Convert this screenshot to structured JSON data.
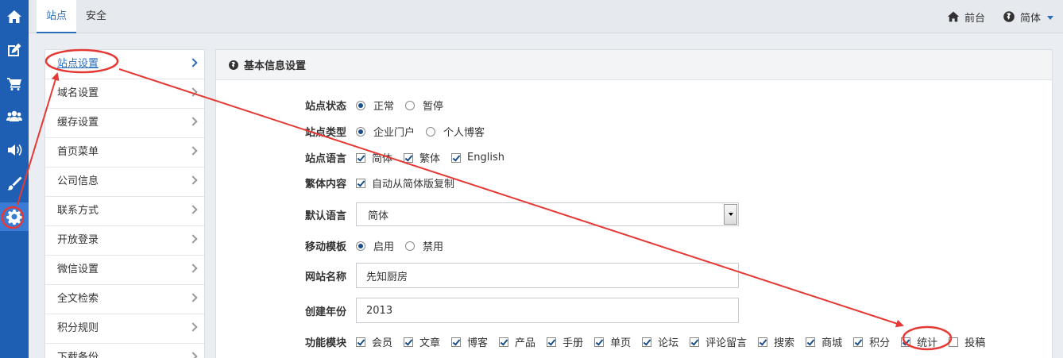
{
  "rail": {
    "items": [
      {
        "icon": "home-icon"
      },
      {
        "icon": "edit-icon"
      },
      {
        "icon": "cart-icon"
      },
      {
        "icon": "users-icon"
      },
      {
        "icon": "speaker-icon"
      },
      {
        "icon": "brush-icon"
      },
      {
        "icon": "gear-icon"
      }
    ]
  },
  "topbar": {
    "tabs": [
      {
        "label": "站点"
      },
      {
        "label": "安全"
      }
    ],
    "frontend_label": "前台",
    "language_label": "简体"
  },
  "submenu": {
    "items": [
      {
        "label": "站点设置"
      },
      {
        "label": "域名设置"
      },
      {
        "label": "缓存设置"
      },
      {
        "label": "首页菜单"
      },
      {
        "label": "公司信息"
      },
      {
        "label": "联系方式"
      },
      {
        "label": "开放登录"
      },
      {
        "label": "微信设置"
      },
      {
        "label": "全文检索"
      },
      {
        "label": "积分规则"
      },
      {
        "label": "下载备份"
      }
    ]
  },
  "panel": {
    "title": "基本信息设置",
    "site_status": {
      "label": "站点状态",
      "options": [
        "正常",
        "暂停"
      ],
      "selected": "正常"
    },
    "site_type": {
      "label": "站点类型",
      "options": [
        "企业门户",
        "个人博客"
      ],
      "selected": "企业门户"
    },
    "site_language": {
      "label": "站点语言",
      "options": [
        "简体",
        "繁体",
        "English"
      ]
    },
    "traditional_content": {
      "label": "繁体内容",
      "option": "自动从简体版复制"
    },
    "default_language": {
      "label": "默认语言",
      "value": "简体"
    },
    "mobile_template": {
      "label": "移动模板",
      "options": [
        "启用",
        "禁用"
      ],
      "selected": "启用"
    },
    "site_name": {
      "label": "网站名称",
      "value": "先知厨房"
    },
    "founded_year": {
      "label": "创建年份",
      "value": "2013"
    },
    "modules": {
      "label": "功能模块",
      "options": [
        {
          "label": "会员",
          "checked": true
        },
        {
          "label": "文章",
          "checked": true
        },
        {
          "label": "博客",
          "checked": true
        },
        {
          "label": "产品",
          "checked": true
        },
        {
          "label": "手册",
          "checked": true
        },
        {
          "label": "单页",
          "checked": true
        },
        {
          "label": "论坛",
          "checked": true
        },
        {
          "label": "评论留言",
          "checked": true
        },
        {
          "label": "搜索",
          "checked": true
        },
        {
          "label": "商城",
          "checked": true
        },
        {
          "label": "积分",
          "checked": true
        },
        {
          "label": "统计",
          "checked": true
        },
        {
          "label": "投稿",
          "checked": false
        }
      ]
    }
  },
  "colors": {
    "rail": "#1e5fb4",
    "accent": "#2a6ebb",
    "annotation": "#e53935"
  }
}
